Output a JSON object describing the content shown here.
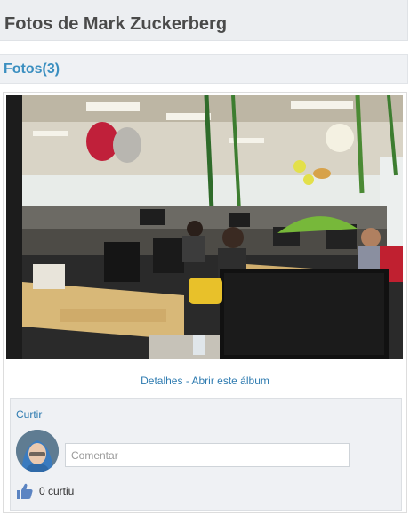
{
  "page": {
    "title": "Fotos de Mark Zuckerberg"
  },
  "section": {
    "title": "Fotos(3)"
  },
  "photo": {
    "alt": "office-photo"
  },
  "album_links": {
    "details": "Detalhes",
    "separator": " - ",
    "open_album": "Abrir este álbum"
  },
  "social": {
    "like_label": "Curtir",
    "comment_placeholder": "Comentar",
    "likes_count_text": "0 curtiu",
    "like_icon": "thumbs-up-icon"
  },
  "colors": {
    "link": "#2e7bb0",
    "section_title": "#3b8fc0",
    "bar_bg": "#eff1f4"
  }
}
